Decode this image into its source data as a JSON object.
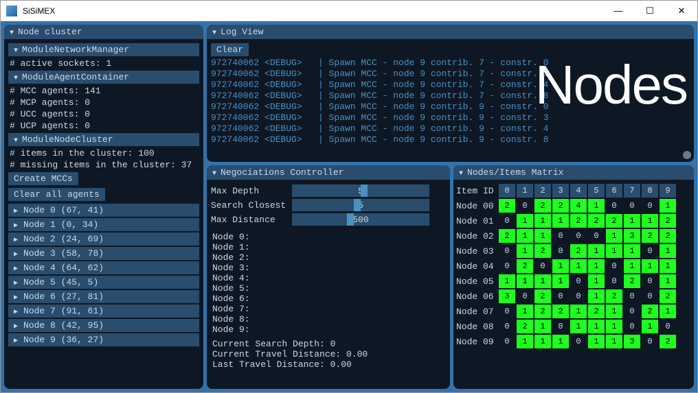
{
  "window": {
    "title": "SiSiMEX"
  },
  "big_label": "Nodes",
  "node_cluster": {
    "title": "Node cluster",
    "sections": [
      {
        "title": "ModuleNetworkManager",
        "stats": [
          "# active sockets: 1"
        ]
      },
      {
        "title": "ModuleAgentContainer",
        "stats": [
          "# MCC agents: 141",
          "# MCP agents: 0",
          "# UCC agents: 0",
          "# UCP agents: 0"
        ]
      },
      {
        "title": "ModuleNodeCluster",
        "stats": [
          "# items in the cluster: 100",
          "# missing items in the cluster: 37"
        ]
      }
    ],
    "buttons": {
      "create": "Create MCCs",
      "clear": "Clear all agents"
    },
    "nodes": [
      "Node 0 (67, 41)",
      "Node 1 (0, 34)",
      "Node 2 (24, 69)",
      "Node 3 (58, 78)",
      "Node 4 (64, 62)",
      "Node 5 (45, 5)",
      "Node 6 (27, 81)",
      "Node 7 (91, 61)",
      "Node 8 (42, 95)",
      "Node 9 (36, 27)"
    ]
  },
  "log": {
    "title": "Log View",
    "clear": "Clear",
    "lines": [
      "972740062 <DEBUG>   | Spawn MCC - node 9 contrib. 7 - constr. 0",
      "972740062 <DEBUG>   | Spawn MCC - node 9 contrib. 7 - constr. 3",
      "972740062 <DEBUG>   | Spawn MCC - node 9 contrib. 7 - constr. 4",
      "972740062 <DEBUG>   | Spawn MCC - node 9 contrib. 7 - constr. 8",
      "972740062 <DEBUG>   | Spawn MCC - node 9 contrib. 9 - constr. 0",
      "972740062 <DEBUG>   | Spawn MCC - node 9 contrib. 9 - constr. 3",
      "972740062 <DEBUG>   | Spawn MCC - node 9 contrib. 9 - constr. 4",
      "972740062 <DEBUG>   | Spawn MCC - node 9 contrib. 9 - constr. 8"
    ]
  },
  "nego": {
    "title": "Negociations Controller",
    "sliders": [
      {
        "label": "Max Depth",
        "value": "5",
        "pos": 50
      },
      {
        "label": "Search Closest",
        "value": "5",
        "pos": 45
      },
      {
        "label": "Max Distance",
        "value": "500",
        "pos": 40
      }
    ],
    "nodelines": [
      "Node 0:",
      "Node 1:",
      "Node 2:",
      "Node 3:",
      "Node 4:",
      "Node 5:",
      "Node 6:",
      "Node 7:",
      "Node 8:",
      "Node 9:"
    ],
    "status": [
      "Current Search Depth: 0",
      "Current Travel Distance: 0.00",
      "Last Travel Distance: 0.00"
    ]
  },
  "matrix": {
    "title": "Nodes/Items Matrix",
    "header_label": "Item ID",
    "cols": [
      "0",
      "1",
      "2",
      "3",
      "4",
      "5",
      "6",
      "7",
      "8",
      "9"
    ],
    "rows": [
      {
        "label": "Node 00",
        "cells": [
          2,
          0,
          2,
          2,
          4,
          1,
          0,
          0,
          0,
          1
        ]
      },
      {
        "label": "Node 01",
        "cells": [
          0,
          1,
          1,
          1,
          2,
          2,
          2,
          1,
          1,
          2
        ]
      },
      {
        "label": "Node 02",
        "cells": [
          2,
          1,
          1,
          0,
          0,
          0,
          1,
          3,
          2,
          2
        ]
      },
      {
        "label": "Node 03",
        "cells": [
          0,
          1,
          2,
          0,
          2,
          1,
          1,
          1,
          0,
          1
        ]
      },
      {
        "label": "Node 04",
        "cells": [
          0,
          2,
          0,
          1,
          1,
          1,
          0,
          1,
          1,
          1
        ]
      },
      {
        "label": "Node 05",
        "cells": [
          1,
          1,
          1,
          1,
          0,
          1,
          0,
          2,
          0,
          1
        ]
      },
      {
        "label": "Node 06",
        "cells": [
          3,
          0,
          2,
          0,
          0,
          1,
          2,
          0,
          0,
          2
        ]
      },
      {
        "label": "Node 07",
        "cells": [
          0,
          1,
          2,
          2,
          1,
          2,
          1,
          0,
          2,
          1
        ]
      },
      {
        "label": "Node 08",
        "cells": [
          0,
          2,
          1,
          0,
          1,
          1,
          1,
          0,
          1,
          0
        ]
      },
      {
        "label": "Node 09",
        "cells": [
          0,
          1,
          1,
          1,
          0,
          1,
          1,
          3,
          0,
          2
        ]
      }
    ]
  }
}
